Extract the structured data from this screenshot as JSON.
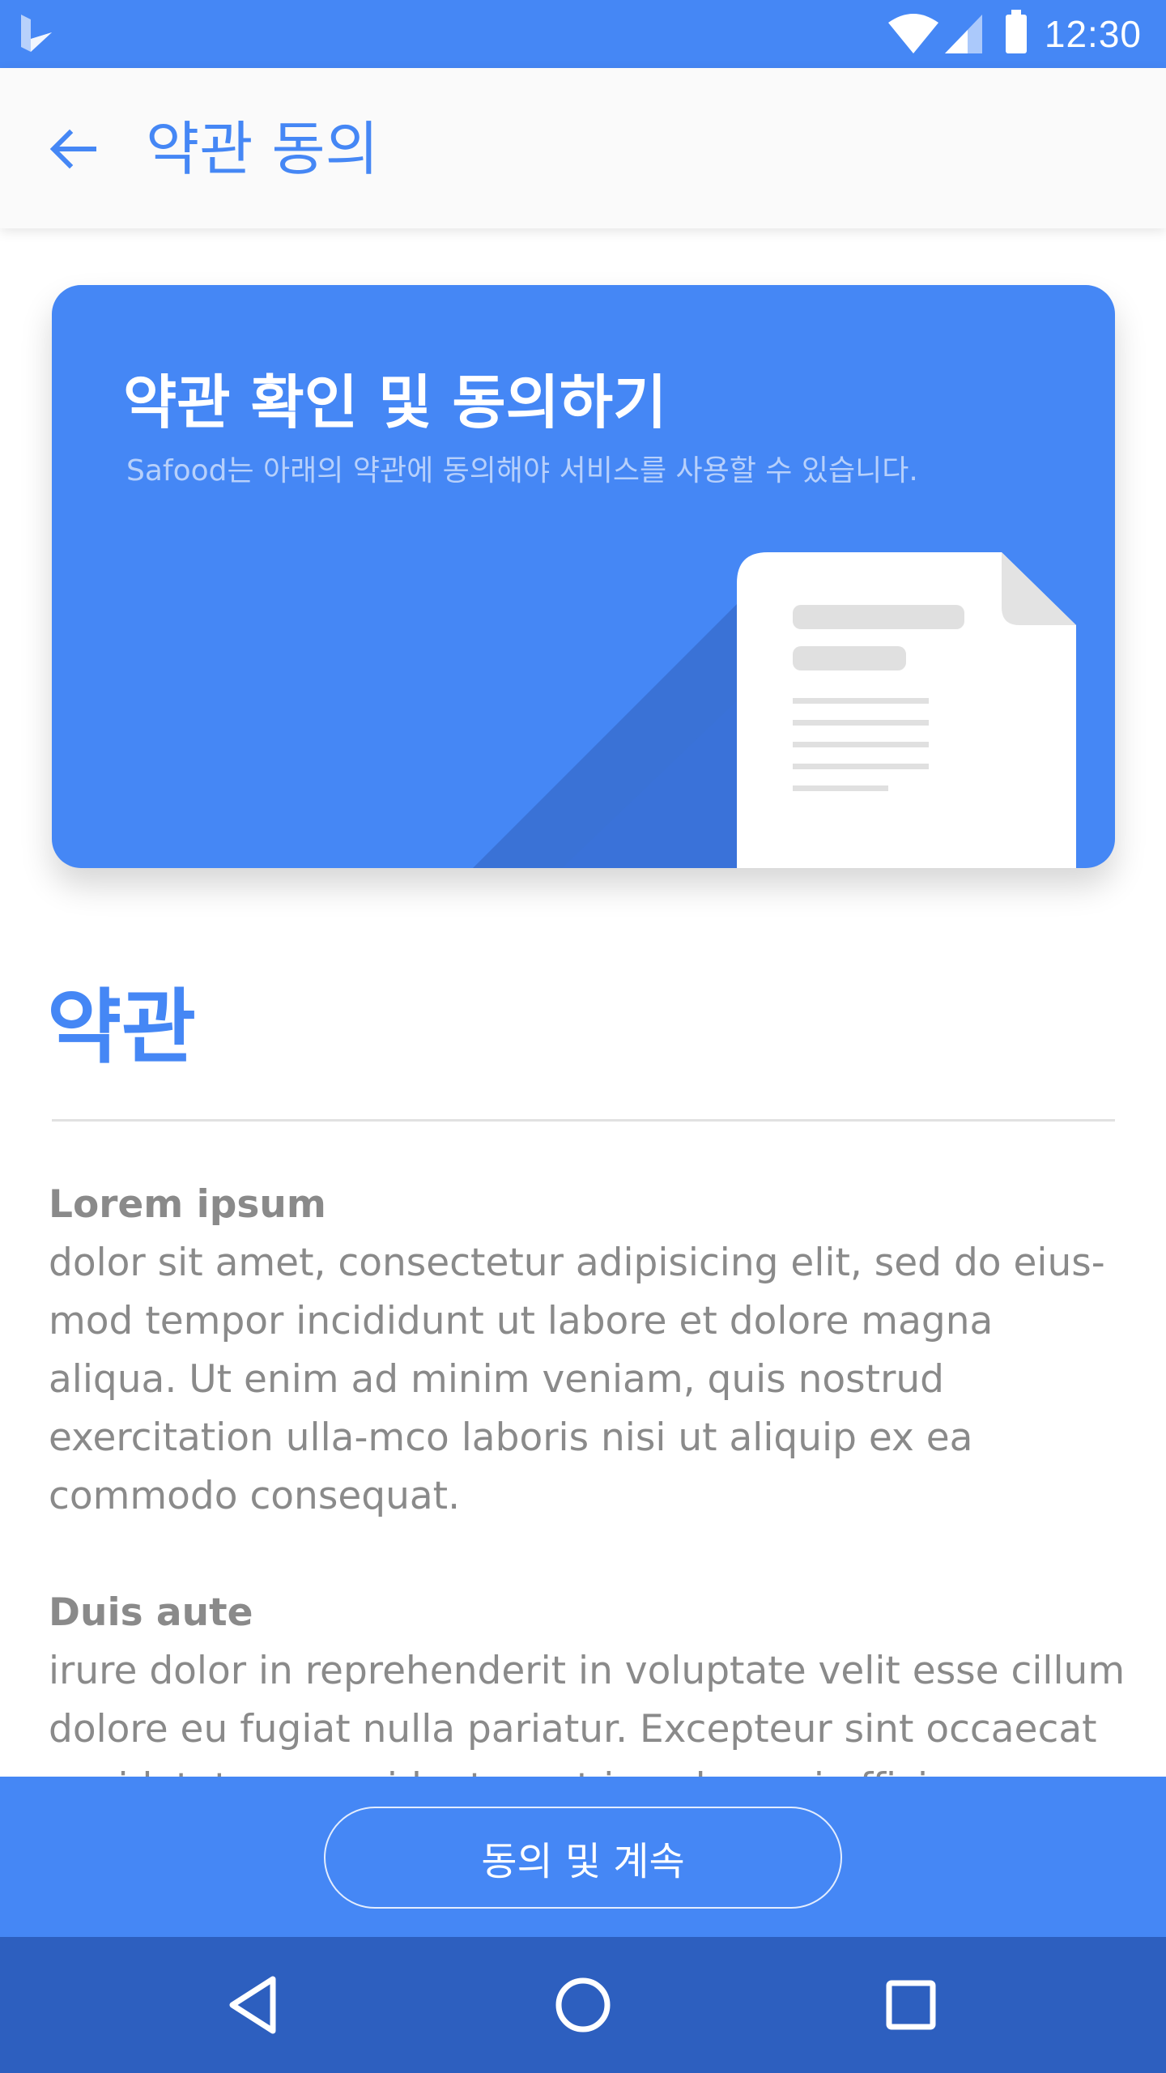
{
  "status_bar": {
    "time": "12:30",
    "icons": [
      "app-logo-icon",
      "wifi-icon",
      "cell-signal-icon",
      "battery-icon"
    ]
  },
  "app_bar": {
    "title": "약관 동의",
    "back_icon": "arrow-back-icon"
  },
  "hero": {
    "title": "약관 확인 및 동의하기",
    "subtitle": "Safood는 아래의 약관에 동의해야 서비스를 사용할 수 있습니다.",
    "illustration_icon": "document-icon"
  },
  "section": {
    "title": "약관"
  },
  "terms": [
    {
      "heading": "Lorem ipsum",
      "body": "dolor sit amet, consectetur adipisicing elit, sed do eius-mod tempor incididunt ut labore et dolore magna aliqua. Ut enim ad minim veniam, quis nostrud exercitation ulla-mco laboris nisi ut aliquip ex ea commodo consequat."
    },
    {
      "heading": "Duis aute",
      "body": "irure dolor in reprehenderit in voluptate velit esse cillum dolore eu fugiat nulla pariatur. Excepteur sint occaecat cupidatat non proident, sunt in culpa qui officia deserunt"
    }
  ],
  "bottom": {
    "agree_label": "동의 및 계속"
  },
  "nav": {
    "icons": [
      "back-triangle-icon",
      "home-circle-icon",
      "recents-square-icon"
    ]
  },
  "colors": {
    "primary": "#4587f5",
    "nav_bar": "#2d5fbf",
    "app_bar": "#fafafa",
    "body_text": "#8a8a8a"
  }
}
